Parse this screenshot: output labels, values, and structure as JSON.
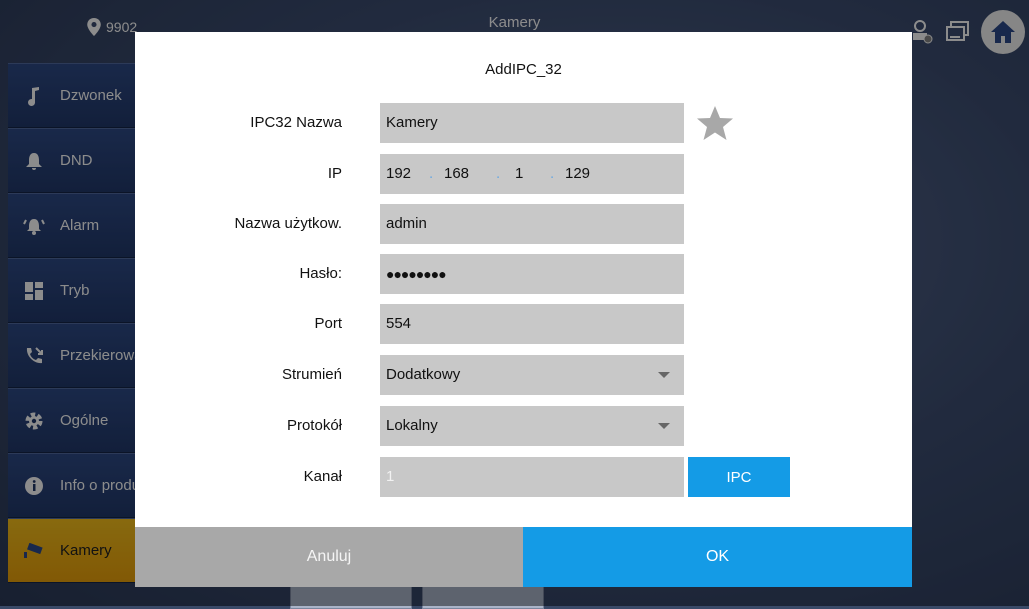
{
  "app": {
    "location": "9902",
    "title": "Kamery"
  },
  "sidebar": {
    "items": [
      {
        "label": "Dzwonek",
        "icon": "music-note-icon"
      },
      {
        "label": "DND",
        "icon": "bell-icon"
      },
      {
        "label": "Alarm",
        "icon": "alarm-icon"
      },
      {
        "label": "Tryb",
        "icon": "mode-icon"
      },
      {
        "label": "Przekierowanie",
        "icon": "call-forward-icon"
      },
      {
        "label": "Ogólne",
        "icon": "gear-icon"
      },
      {
        "label": "Info o produkcie",
        "icon": "info-icon"
      },
      {
        "label": "Kamery",
        "icon": "camera-icon",
        "active": true
      }
    ]
  },
  "dialog": {
    "title": "AddIPC_32",
    "fields": {
      "name_label": "IPC32 Nazwa",
      "name_value": "Kamery",
      "ip_label": "IP",
      "ip": [
        "192",
        "168",
        "1",
        "129"
      ],
      "user_label": "Nazwa użytkow.",
      "user_value": "admin",
      "password_label": "Hasło:",
      "password_value": "●●●●●●●●",
      "port_label": "Port",
      "port_value": "554",
      "stream_label": "Strumień",
      "stream_value": "Dodatkowy",
      "protocol_label": "Protokół",
      "protocol_value": "Lokalny",
      "channel_label": "Kanał",
      "channel_value": "1"
    },
    "ipc_button": "IPC",
    "cancel_button": "Anuluj",
    "ok_button": "OK"
  },
  "colors": {
    "accent": "#149be6",
    "active_sidebar": "#f0b014",
    "field_bg": "#c8c8c8"
  }
}
